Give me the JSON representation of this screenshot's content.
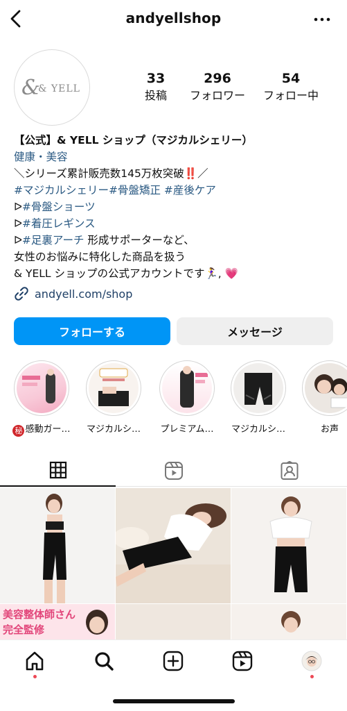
{
  "header": {
    "username": "andyellshop"
  },
  "profile": {
    "avatar_text": "& YELL",
    "stats": [
      {
        "value": "33",
        "label": "投稿"
      },
      {
        "value": "296",
        "label": "フォロワー"
      },
      {
        "value": "54",
        "label": "フォロー中"
      }
    ],
    "bio": {
      "name": "【公式】& YELL ショップ（マジカルシェリー）",
      "category": "健康・美容",
      "line1_pre": "＼シリーズ累計販売数145万枚突破",
      "line1_emoji": "‼️",
      "line1_post": "／",
      "line2_tags": "#マジカルシェリー#骨盤矯正 #産後ケア",
      "line3_prefix": "ᐅ",
      "line3_tag": "#骨盤ショーツ",
      "line4_prefix": "ᐅ",
      "line4_tag": "#着圧レギンス",
      "line5_prefix": "ᐅ",
      "line5_tag": "#足裏アーチ",
      "line5_text": " 形成サポーターなど、",
      "line6": "女性のお悩みに特化した商品を扱う",
      "line7": "& YELL ショップの公式アカウントです",
      "line7_emoji": "🏃‍♀️, 💗",
      "link": "andyell.com/shop"
    }
  },
  "actions": {
    "follow": "フォローする",
    "message": "メッセージ"
  },
  "highlights": [
    {
      "badge": "秘",
      "label": "感動ガー…"
    },
    {
      "label": "マジカルシ…"
    },
    {
      "label": "プレミアム…"
    },
    {
      "label": "マジカルシ…"
    },
    {
      "label": "お声"
    }
  ],
  "tabs": [
    "grid",
    "reels",
    "tagged"
  ],
  "posts_overlay_text": "美容整体師さん\n完全監修",
  "colors": {
    "accent": "#0095f6",
    "link": "#2b5a83",
    "notification": "#ed4956"
  }
}
